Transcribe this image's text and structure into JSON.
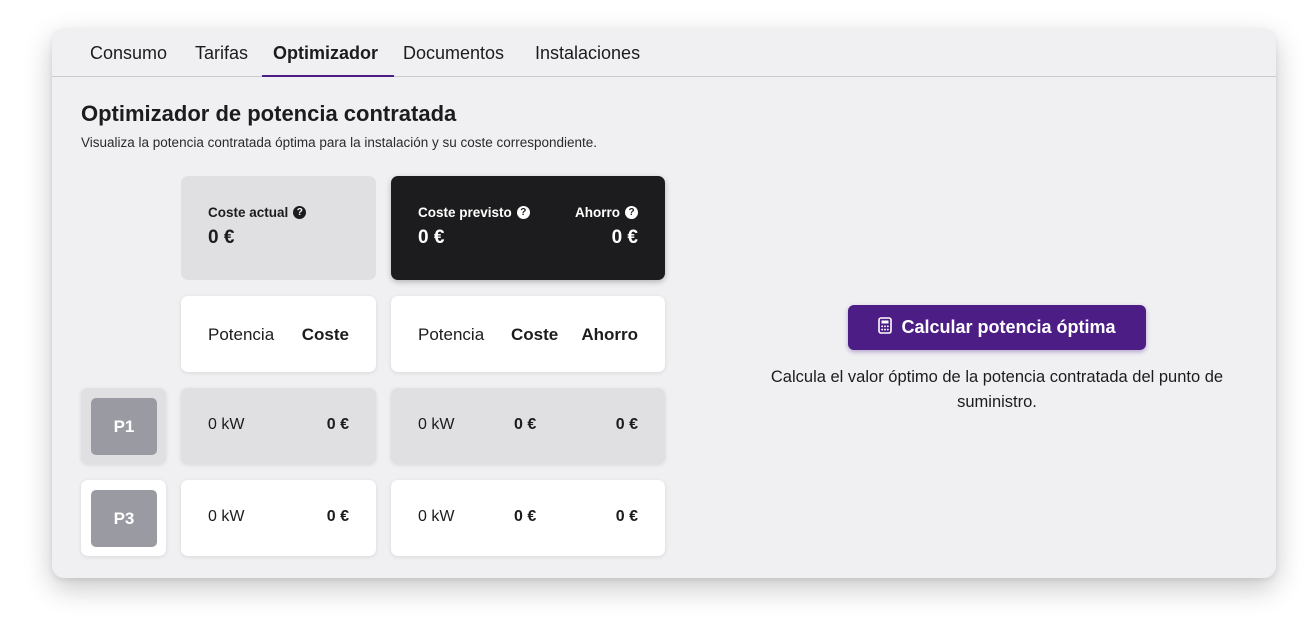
{
  "tabs": [
    {
      "label": "Consumo",
      "active": false
    },
    {
      "label": "Tarifas",
      "active": false
    },
    {
      "label": "Optimizador",
      "active": true
    },
    {
      "label": "Documentos",
      "active": false
    },
    {
      "label": "Instalaciones",
      "active": false
    }
  ],
  "page": {
    "title": "Optimizador de potencia contratada",
    "subtitle": "Visualiza la potencia contratada óptima para la instalación y su coste correspondiente."
  },
  "summary": {
    "current_cost_label": "Coste actual",
    "current_cost_value": "0 €",
    "forecast_cost_label": "Coste previsto",
    "forecast_cost_value": "0 €",
    "savings_label": "Ahorro",
    "savings_value": "0 €",
    "help_glyph": "?"
  },
  "headers": {
    "potencia": "Potencia",
    "coste": "Coste",
    "ahorro": "Ahorro"
  },
  "periods": [
    {
      "label": "P1",
      "current_power": "0 kW",
      "current_cost": "0 €",
      "optimal_power": "0 kW",
      "optimal_cost": "0 €",
      "savings": "0 €"
    },
    {
      "label": "P3",
      "current_power": "0 kW",
      "current_cost": "0 €",
      "optimal_power": "0 kW",
      "optimal_cost": "0 €",
      "savings": "0 €"
    }
  ],
  "action": {
    "button_label": "Calcular potencia óptima",
    "button_icon": "calculator-icon",
    "description": "Calcula el valor óptimo de la potencia contratada del punto de suministro."
  },
  "colors": {
    "accent": "#4b1d85",
    "dark_card": "#1c1c1e",
    "period_chip": "#9a9aa2",
    "background": "#f0f0f2"
  }
}
